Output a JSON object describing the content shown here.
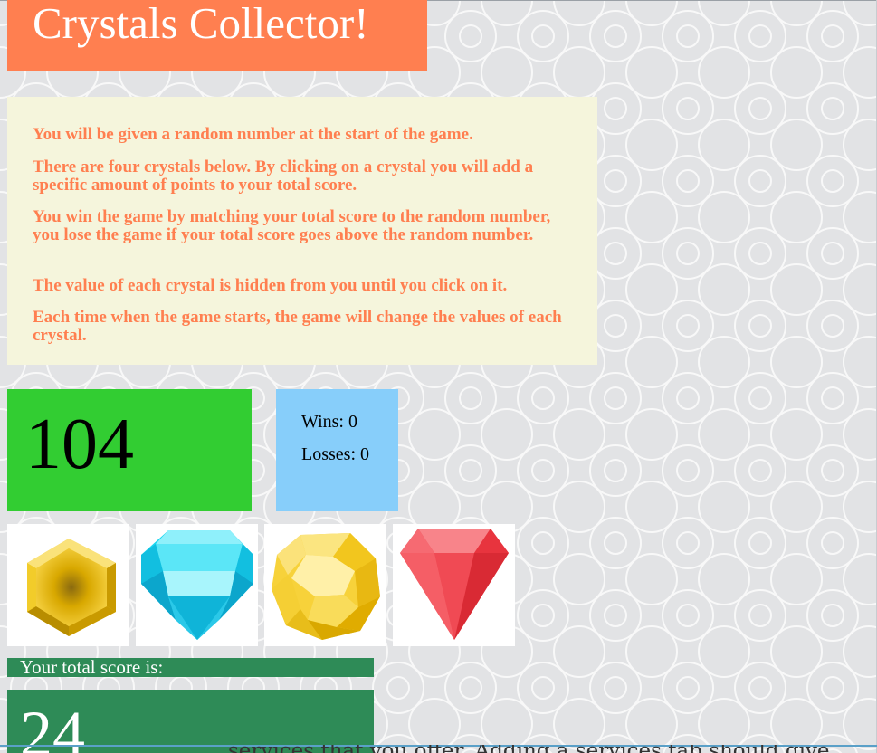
{
  "header": {
    "title": "Crystals Collector!"
  },
  "instructions": [
    "You will be given a random number at the start of the game.",
    "There are four crystals below. By clicking on a crystal you will add a specific amount of points to your total score.",
    "You win the game by matching your total score to the random number, you lose the game if your total score goes above the random number.",
    "The value of each crystal is hidden from you until you click on it.",
    "Each time when the game starts, the game will change the values of each crystal."
  ],
  "game": {
    "target_number": "104",
    "wins": "Wins: 0",
    "losses": "Losses: 0",
    "score_label": "Your total score is:",
    "total_score": "24"
  },
  "crystals": [
    {
      "name": "yellow-hexagon-crystal",
      "color": "#e0b400"
    },
    {
      "name": "cyan-diamond-crystal",
      "color": "#1ad6f0"
    },
    {
      "name": "yellow-round-crystal",
      "color": "#f7d23a"
    },
    {
      "name": "red-triangle-crystal",
      "color": "#f04850"
    }
  ],
  "overflow_text": "services that you offer. Adding a services tab should give"
}
